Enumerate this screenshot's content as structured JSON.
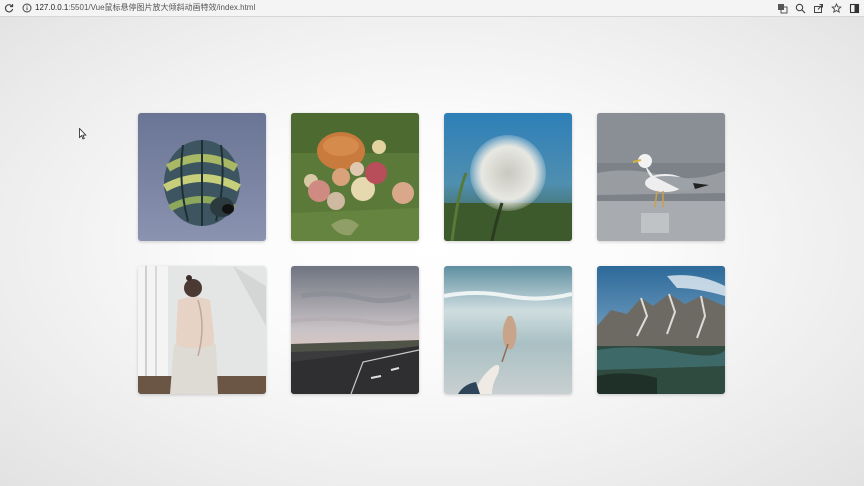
{
  "browser": {
    "url_host": "127.0.0.1",
    "url_rest": ":5501/Vue鼠标悬停图片放大倾斜动画特效/index.html",
    "icons": [
      "reload-icon",
      "info-icon",
      "translate-icon",
      "zoom-icon",
      "share-icon",
      "star-icon",
      "sidebar-icon"
    ]
  },
  "gallery": {
    "images": [
      {
        "subject": "hot-air-balloon"
      },
      {
        "subject": "apples-and-pumpkin"
      },
      {
        "subject": "dandelion"
      },
      {
        "subject": "seagull"
      },
      {
        "subject": "woman-back"
      },
      {
        "subject": "road"
      },
      {
        "subject": "hand-holding-leaf"
      },
      {
        "subject": "mountains"
      }
    ]
  }
}
